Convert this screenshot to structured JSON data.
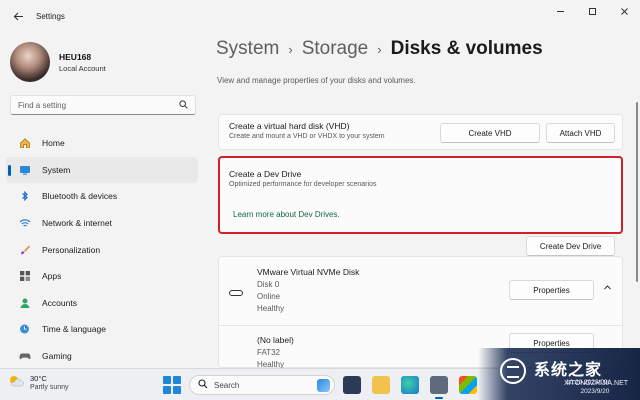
{
  "window": {
    "title": "Settings",
    "back_icon": "back-arrow-icon",
    "controls": [
      "minimize-icon",
      "maximize-icon",
      "close-icon"
    ]
  },
  "profile": {
    "name": "HEU168",
    "account_type": "Local Account"
  },
  "search": {
    "placeholder": "Find a setting"
  },
  "sidebar": {
    "items": [
      {
        "label": "Home",
        "icon": "home-icon",
        "active": false
      },
      {
        "label": "System",
        "icon": "system-icon",
        "active": true
      },
      {
        "label": "Bluetooth & devices",
        "icon": "bluetooth-icon",
        "active": false
      },
      {
        "label": "Network & internet",
        "icon": "wifi-icon",
        "active": false
      },
      {
        "label": "Personalization",
        "icon": "brush-icon",
        "active": false
      },
      {
        "label": "Apps",
        "icon": "apps-icon",
        "active": false
      },
      {
        "label": "Accounts",
        "icon": "accounts-icon",
        "active": false
      },
      {
        "label": "Time & language",
        "icon": "globe-clock-icon",
        "active": false
      },
      {
        "label": "Gaming",
        "icon": "gaming-icon",
        "active": false
      }
    ]
  },
  "breadcrumb": {
    "items": [
      "System",
      "Storage"
    ],
    "current": "Disks & volumes"
  },
  "page": {
    "description": "View and manage properties of your disks and volumes."
  },
  "vhd_card": {
    "title": "Create a virtual hard disk (VHD)",
    "subtitle": "Create and mount a VHD or VHDX to your system",
    "create_button": "Create VHD",
    "attach_button": "Attach VHD"
  },
  "dev_drive_card": {
    "title": "Create a Dev Drive",
    "subtitle": "Optimized performance for developer scenarios",
    "learn_more_link": "Learn more about Dev Drives.",
    "create_button": "Create Dev Drive"
  },
  "disk": {
    "name": "VMware Virtual NVMe Disk",
    "disk_number": "Disk 0",
    "status": "Online",
    "health": "Healthy",
    "properties_button": "Properties",
    "volumes": [
      {
        "label": "(No label)",
        "filesystem": "FAT32",
        "health": "Healthy",
        "properties_button": "Properties"
      }
    ]
  },
  "taskbar": {
    "weather_temp": "30°C",
    "weather_desc": "Partly sunny",
    "search_placeholder": "Search",
    "apps": [
      "news-app-icon",
      "file-explorer-icon",
      "edge-icon",
      "settings-app-icon",
      "store-icon",
      "explorer-icon"
    ],
    "clock_time": "10:20 2023/09/",
    "clock_date": "2023/9/20"
  },
  "watermark": {
    "brand": "系统之家",
    "url": "XITONGZHIJIA.NET"
  },
  "colors": {
    "accent": "#005fb8",
    "highlight_border": "#d1202a",
    "link": "#0f6b3f",
    "background": "#f3f3f3"
  }
}
